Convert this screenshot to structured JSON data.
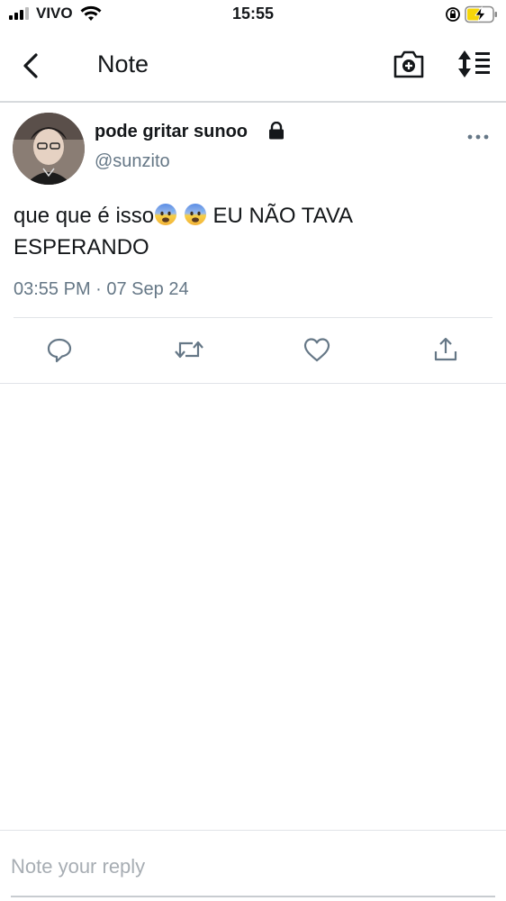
{
  "status_bar": {
    "carrier": "VIVO",
    "time": "15:55",
    "icons": [
      "signal-icon",
      "wifi-icon",
      "orientation-lock-icon",
      "battery-charging-icon"
    ]
  },
  "nav": {
    "title": "Note",
    "icons": [
      "back-chevron-icon",
      "camera-plus-icon",
      "sort-icon"
    ]
  },
  "post": {
    "display_name": "pode gritar sunoo",
    "handle": "@sunzito",
    "text_part1": "que que é isso",
    "text_part2": "EU NÃO TAVA ESPERANDO",
    "emoji": "anxious-face-with-sweat",
    "timestamp": "03:55 PM · 07 Sep 24",
    "actions": [
      "reply-icon",
      "retweet-icon",
      "like-icon",
      "share-icon"
    ]
  },
  "reply": {
    "placeholder": "Note your reply"
  },
  "colors": {
    "text": "#14171a",
    "secondary": "#657786",
    "icon": "#657786",
    "divider": "#e1e4e8",
    "battery": "#f5d60a"
  }
}
